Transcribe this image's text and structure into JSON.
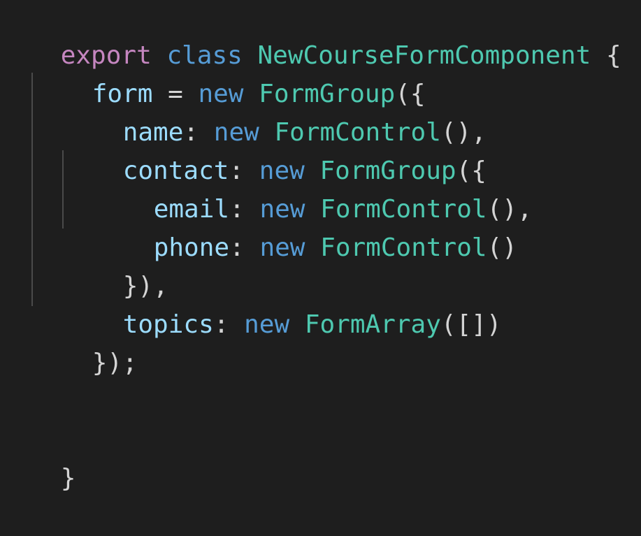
{
  "editor": {
    "lines": [
      {
        "tokens": [
          "export",
          " ",
          "class",
          " ",
          "NewCourseFormComponent",
          " ",
          "{"
        ]
      },
      {
        "tokens": [
          "form",
          " = ",
          "new",
          " ",
          "FormGroup",
          "({"
        ]
      },
      {
        "tokens": [
          "name",
          ": ",
          "new",
          " ",
          "FormControl",
          "(),"
        ]
      },
      {
        "tokens": [
          "contact",
          ": ",
          "new",
          " ",
          "FormGroup",
          "({"
        ]
      },
      {
        "tokens": [
          "email",
          ": ",
          "new",
          " ",
          "FormControl",
          "(),"
        ]
      },
      {
        "tokens": [
          "phone",
          ": ",
          "new",
          " ",
          "FormControl",
          "()"
        ]
      },
      {
        "tokens": [
          "}),"
        ]
      },
      {
        "tokens": [
          "topics",
          ": ",
          "new",
          " ",
          "FormArray",
          "([])"
        ]
      },
      {
        "tokens": [
          "});"
        ]
      },
      {
        "tokens": [
          "}"
        ]
      }
    ]
  },
  "colors": {
    "background": "#1e1e1e",
    "keyword": "#c586c0",
    "storage": "#569cd6",
    "class_name": "#4ec9b0",
    "property": "#9cdcfe",
    "punctuation": "#d4d4d4",
    "indent_guide": "#4a4a4a"
  }
}
